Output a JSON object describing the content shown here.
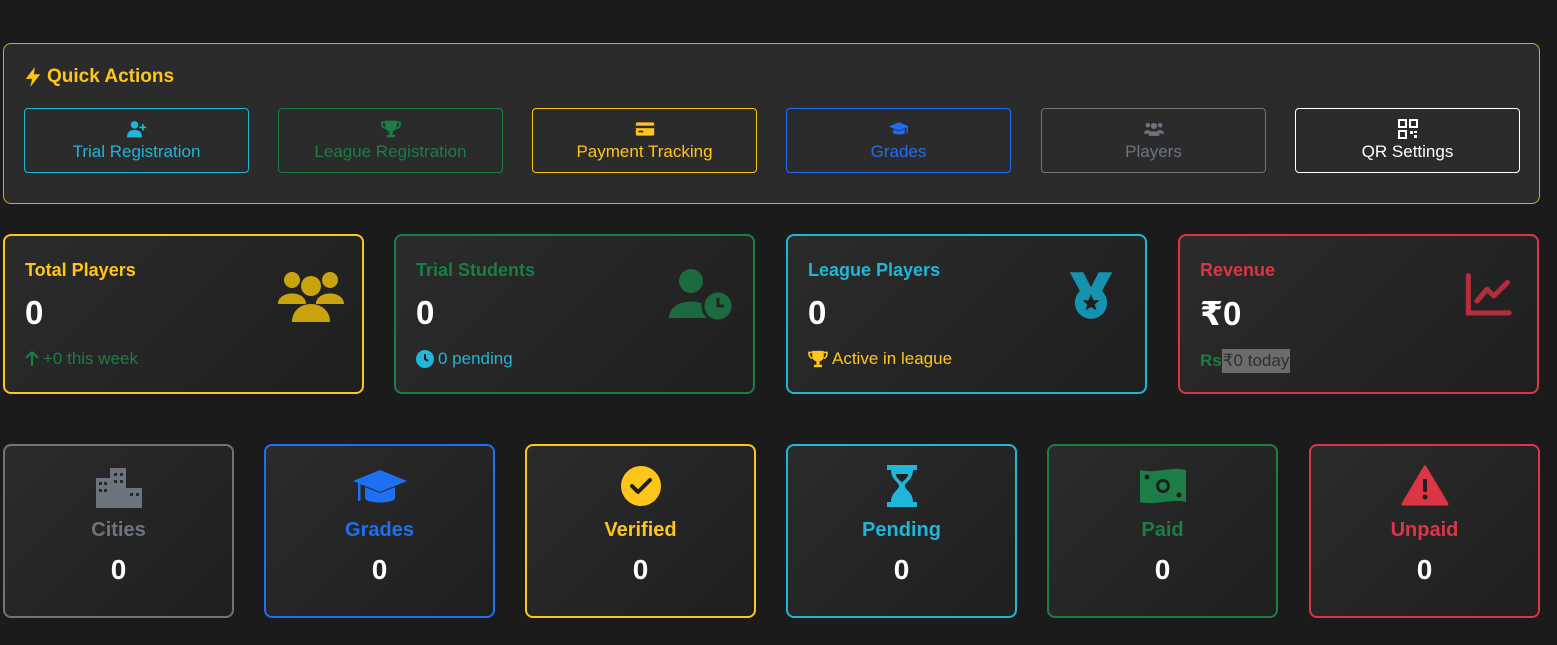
{
  "quick_actions": {
    "title": "Quick Actions",
    "icon": "bolt-icon",
    "buttons": [
      {
        "label": "Trial Registration",
        "icon": "user-plus-icon",
        "color": "#1fb6d8"
      },
      {
        "label": "League Registration",
        "icon": "trophy-icon",
        "color": "#1c7d47"
      },
      {
        "label": "Payment Tracking",
        "icon": "credit-card-icon",
        "color": "#ffc61a"
      },
      {
        "label": "Grades",
        "icon": "graduation-cap-icon",
        "color": "#1f6ff2"
      },
      {
        "label": "Players",
        "icon": "users-icon",
        "color": "#6c757d"
      },
      {
        "label": "QR Settings",
        "icon": "qrcode-icon",
        "color": "#ffffff"
      }
    ]
  },
  "stats": [
    {
      "title": "Total Players",
      "value": "0",
      "sub": "+0 this week",
      "sub_icon": "arrow-up-icon",
      "icon": "users-icon",
      "color": "#ffc61a",
      "sub_color": "#1c7d47"
    },
    {
      "title": "Trial Students",
      "value": "0",
      "sub": "0 pending",
      "sub_icon": "clock-icon",
      "icon": "user-clock-icon",
      "color": "#1c7d47",
      "sub_color": "#1fb6d8"
    },
    {
      "title": "League Players",
      "value": "0",
      "sub": "Active in league",
      "sub_icon": "trophy-icon",
      "icon": "medal-icon",
      "color": "#1fb6d8",
      "sub_color": "#ffc61a"
    },
    {
      "title": "Revenue",
      "value": "₹0",
      "sub_prefix": "Rs",
      "sub": "₹0 today",
      "icon": "chart-line-icon",
      "color": "#dc3545",
      "sub_color": "#1c7d47"
    }
  ],
  "summary": [
    {
      "label": "Cities",
      "value": "0",
      "icon": "city-icon",
      "color": "#6c757d"
    },
    {
      "label": "Grades",
      "value": "0",
      "icon": "graduation-cap-icon",
      "color": "#1f6ff2"
    },
    {
      "label": "Verified",
      "value": "0",
      "icon": "check-circle-icon",
      "color": "#ffc61a"
    },
    {
      "label": "Pending",
      "value": "0",
      "icon": "hourglass-icon",
      "color": "#1fb6d8"
    },
    {
      "label": "Paid",
      "value": "0",
      "icon": "money-bill-icon",
      "color": "#1c7d47"
    },
    {
      "label": "Unpaid",
      "value": "0",
      "icon": "warning-icon",
      "color": "#dc3545"
    }
  ]
}
